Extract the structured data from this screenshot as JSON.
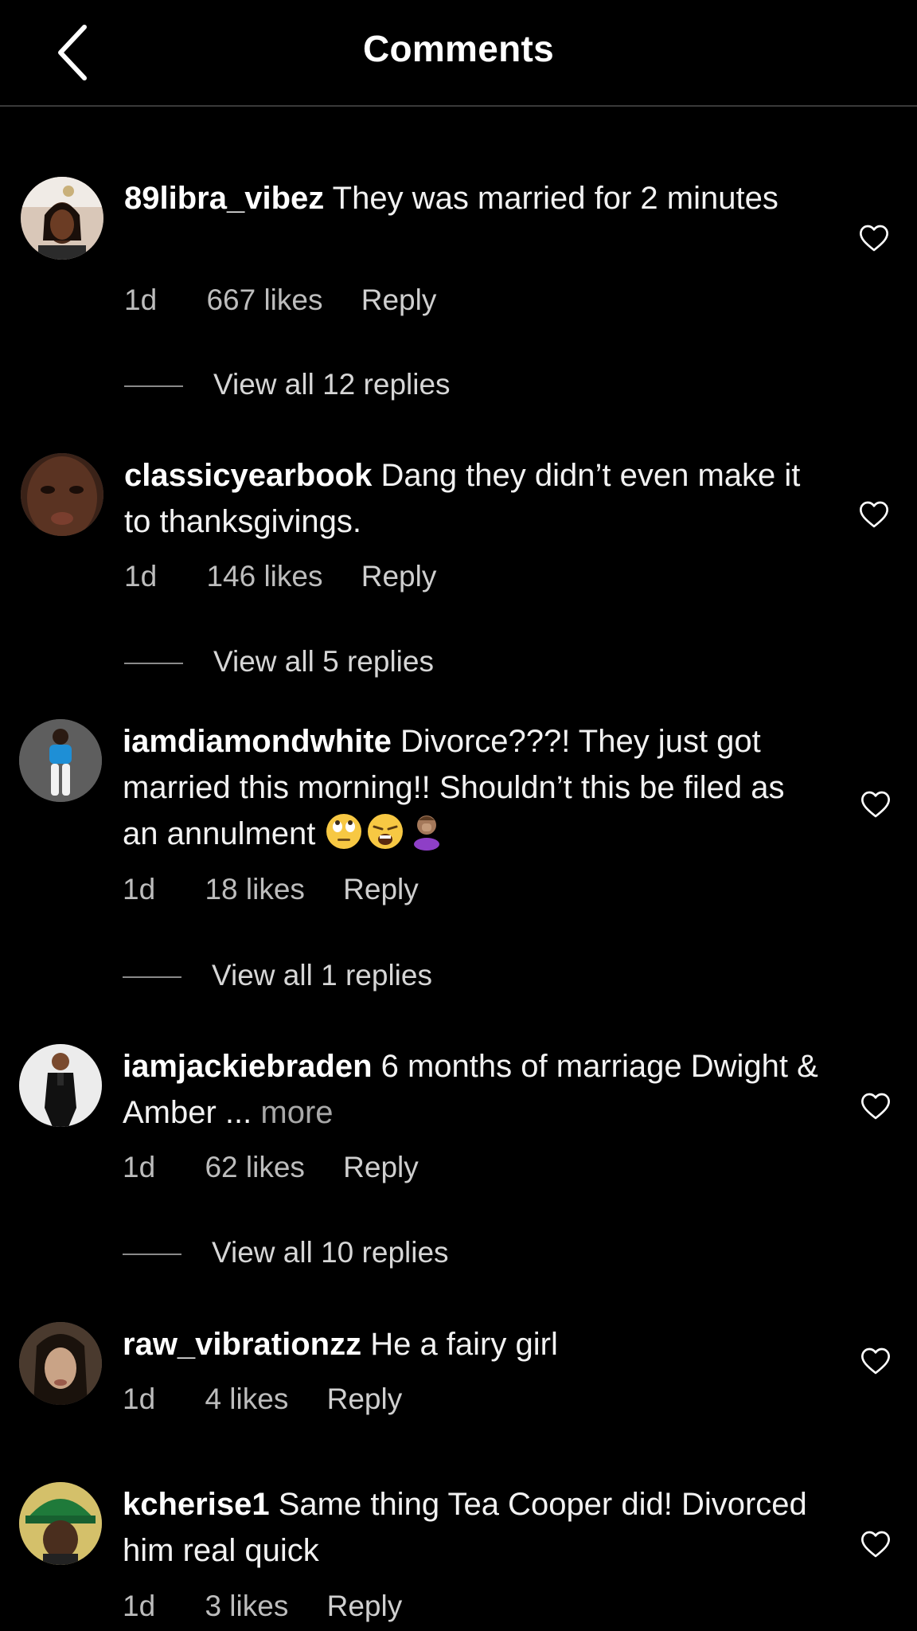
{
  "header": {
    "title": "Comments"
  },
  "comments": [
    {
      "username": "89libra_vibez",
      "text": "They was married for 2 minutes",
      "time": "1d",
      "likes": "667 likes",
      "reply": "Reply",
      "view_replies": "View all 12 replies"
    },
    {
      "username": "classicyearbook",
      "text": "Dang they didn’t even make it to thanksgivings.",
      "time": "1d",
      "likes": "146 likes",
      "reply": "Reply",
      "view_replies": "View all 5 replies"
    },
    {
      "username": "iamdiamondwhite",
      "text": "Divorce???! They just got married this morning!! Shouldn’t this be filed as an annulment",
      "emojis": [
        "eye-roll-emoji",
        "weary-face-emoji",
        "facepalm-emoji"
      ],
      "time": "1d",
      "likes": "18 likes",
      "reply": "Reply",
      "view_replies": "View all 1 replies"
    },
    {
      "username": "iamjackiebraden",
      "text": "6 months of marriage Dwight & Amber ...",
      "more": "more",
      "time": "1d",
      "likes": "62 likes",
      "reply": "Reply",
      "view_replies": "View all 10 replies"
    },
    {
      "username": "raw_vibrationzz",
      "text": "He a fairy girl",
      "time": "1d",
      "likes": "4 likes",
      "reply": "Reply"
    },
    {
      "username": "kcherise1",
      "text": "Same thing Tea Cooper did! Divorced him real quick",
      "time": "1d",
      "likes": "3 likes",
      "reply": "Reply"
    }
  ],
  "icons": {
    "back": "chevron-left-icon",
    "like": "heart-outline-icon"
  },
  "colors": {
    "background": "#000000",
    "text": "#ffffff",
    "secondary_text": "#bdbdbd",
    "divider": "#3a3a3a"
  }
}
